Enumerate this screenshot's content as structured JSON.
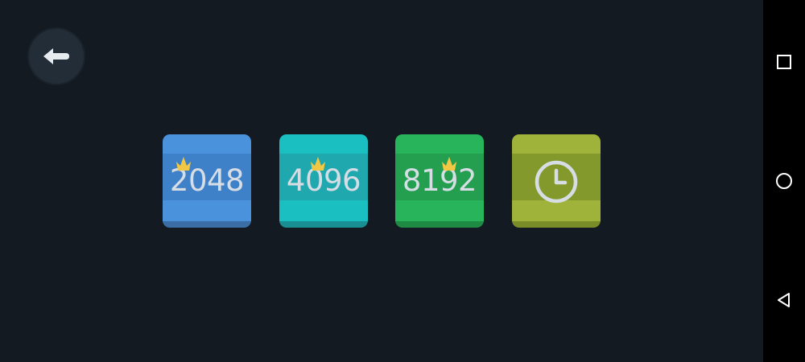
{
  "colors": {
    "background": "#141a21",
    "back_button": "#222d38",
    "tile_text": "#d6dde5",
    "crown": "#f2c744"
  },
  "back_button": {
    "icon": "arrow-left-icon"
  },
  "tiles": [
    {
      "id": "2048",
      "label": "2048",
      "has_crown": true,
      "colors": {
        "top": "#4b92dc",
        "mid": "#3f81c9",
        "bot": "#4b92dc",
        "shadow": "#3a6ea5"
      }
    },
    {
      "id": "4096",
      "label": "4096",
      "has_crown": true,
      "colors": {
        "top": "#19bfc1",
        "mid": "#1fa8ad",
        "bot": "#19bfc1",
        "shadow": "#1a8f93"
      }
    },
    {
      "id": "8192",
      "label": "8192",
      "has_crown": true,
      "colors": {
        "top": "#27b45a",
        "mid": "#239f4f",
        "bot": "#27b45a",
        "shadow": "#1f8a44"
      }
    },
    {
      "id": "time",
      "label": "",
      "icon": "clock-icon",
      "has_crown": false,
      "colors": {
        "top": "#9fb33a",
        "mid": "#84992b",
        "bot": "#9fb33a",
        "shadow": "#7a8c27"
      }
    }
  ],
  "navbar": {
    "items": [
      {
        "name": "recents-button",
        "icon": "square-icon"
      },
      {
        "name": "home-button",
        "icon": "circle-icon"
      },
      {
        "name": "back-nav-button",
        "icon": "triangle-back-icon"
      }
    ]
  }
}
